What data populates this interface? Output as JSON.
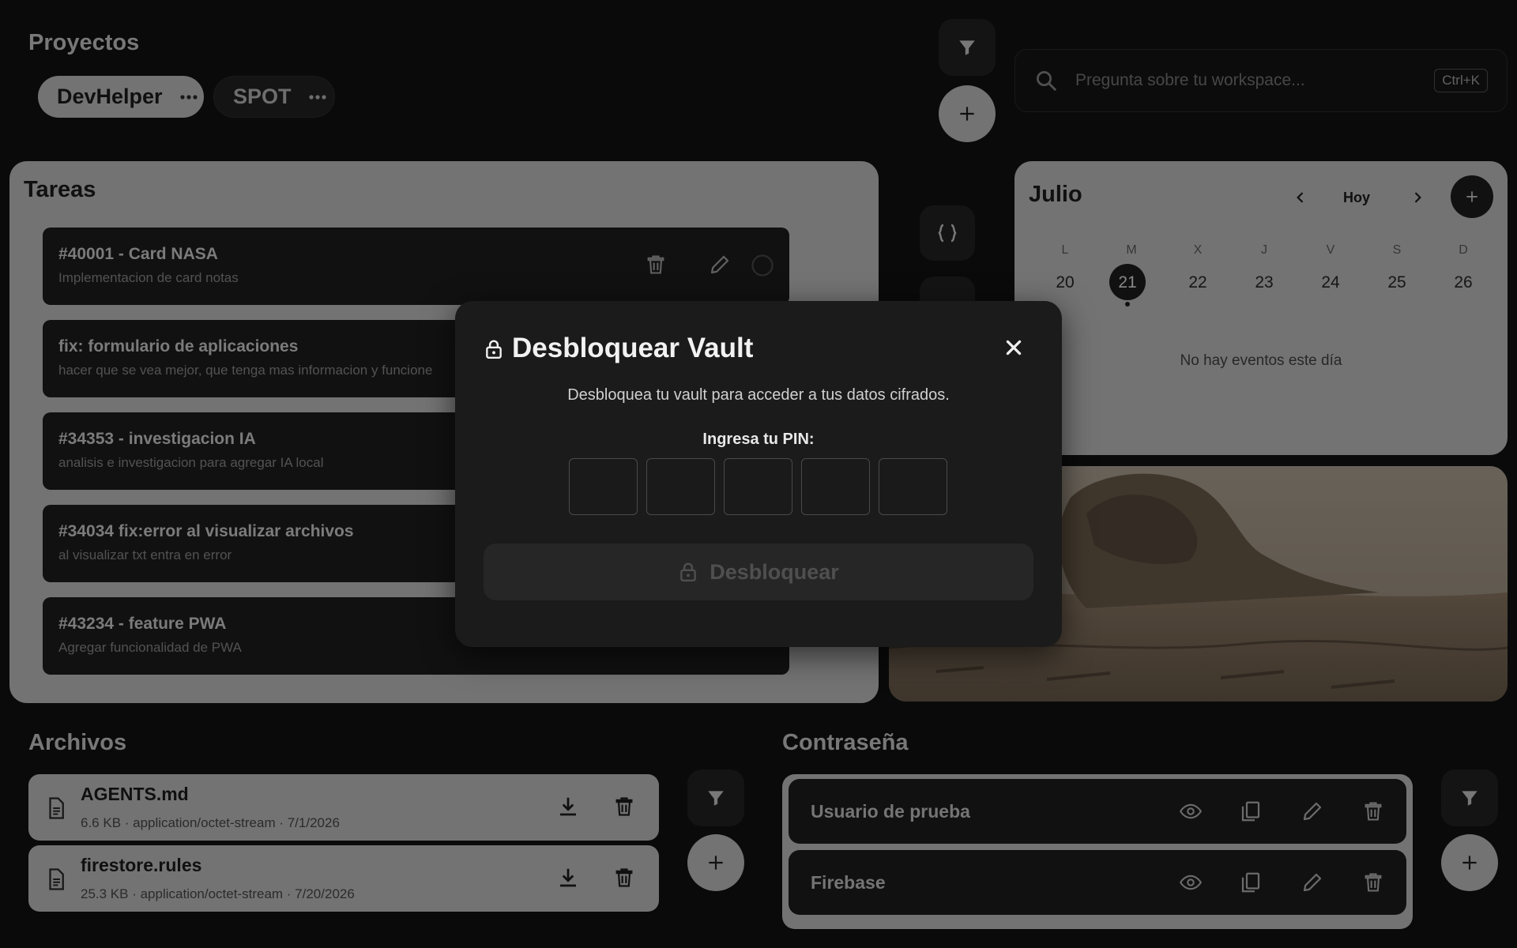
{
  "header": {
    "projects_title": "Proyectos",
    "projects": [
      {
        "name": "DevHelper",
        "active": true
      },
      {
        "name": "SPOT",
        "active": false
      }
    ]
  },
  "search": {
    "placeholder": "Pregunta sobre tu workspace...",
    "shortcut": "Ctrl+K"
  },
  "tasks": {
    "title": "Tareas",
    "items": [
      {
        "title": "#40001 - Card NASA",
        "desc": "Implementacion de card notas"
      },
      {
        "title": "fix: formulario de aplicaciones",
        "desc": "hacer que se vea mejor, que tenga mas informacion y funcione"
      },
      {
        "title": "#34353 - investigacion IA",
        "desc": "analisis e investigacion para agregar IA local"
      },
      {
        "title": "#34034 fix:error al visualizar archivos",
        "desc": "al visualizar txt entra en error"
      },
      {
        "title": "#43234 - feature PWA",
        "desc": "Agregar funcionalidad de PWA"
      }
    ]
  },
  "calendar": {
    "month": "Julio",
    "today_label": "Hoy",
    "weekdays": [
      "L",
      "M",
      "X",
      "J",
      "V",
      "S",
      "D"
    ],
    "days": [
      "20",
      "21",
      "22",
      "23",
      "24",
      "25",
      "26"
    ],
    "selected_day": "21",
    "empty_text": "No hay eventos este día"
  },
  "files": {
    "title": "Archivos",
    "items": [
      {
        "name": "AGENTS.md",
        "meta": "6.6 KB · application/octet-stream · 7/1/2026"
      },
      {
        "name": "firestore.rules",
        "meta": "25.3 KB · application/octet-stream · 7/20/2026"
      }
    ]
  },
  "passwords": {
    "title": "Contraseña",
    "items": [
      {
        "name": "Usuario de prueba"
      },
      {
        "name": "Firebase"
      }
    ]
  },
  "modal": {
    "title": "Desbloquear Vault",
    "subtitle": "Desbloquea tu vault para acceder a tus datos cifrados.",
    "pin_label": "Ingresa tu PIN:",
    "pin_length": 5,
    "unlock_label": "Desbloquear"
  },
  "colors": {
    "background": "#121212",
    "card_light": "#c6c6c6",
    "card_dark": "#1e1e1e",
    "modal_bg": "#1b1b1b"
  },
  "icons": [
    "filter-icon",
    "plus-icon",
    "search-icon",
    "more-icon",
    "trash-icon",
    "pencil-icon",
    "circle-icon",
    "chevron-left-icon",
    "chevron-right-icon",
    "braces-icon",
    "file-icon",
    "download-icon",
    "eye-icon",
    "copy-icon",
    "lock-icon",
    "close-icon"
  ]
}
